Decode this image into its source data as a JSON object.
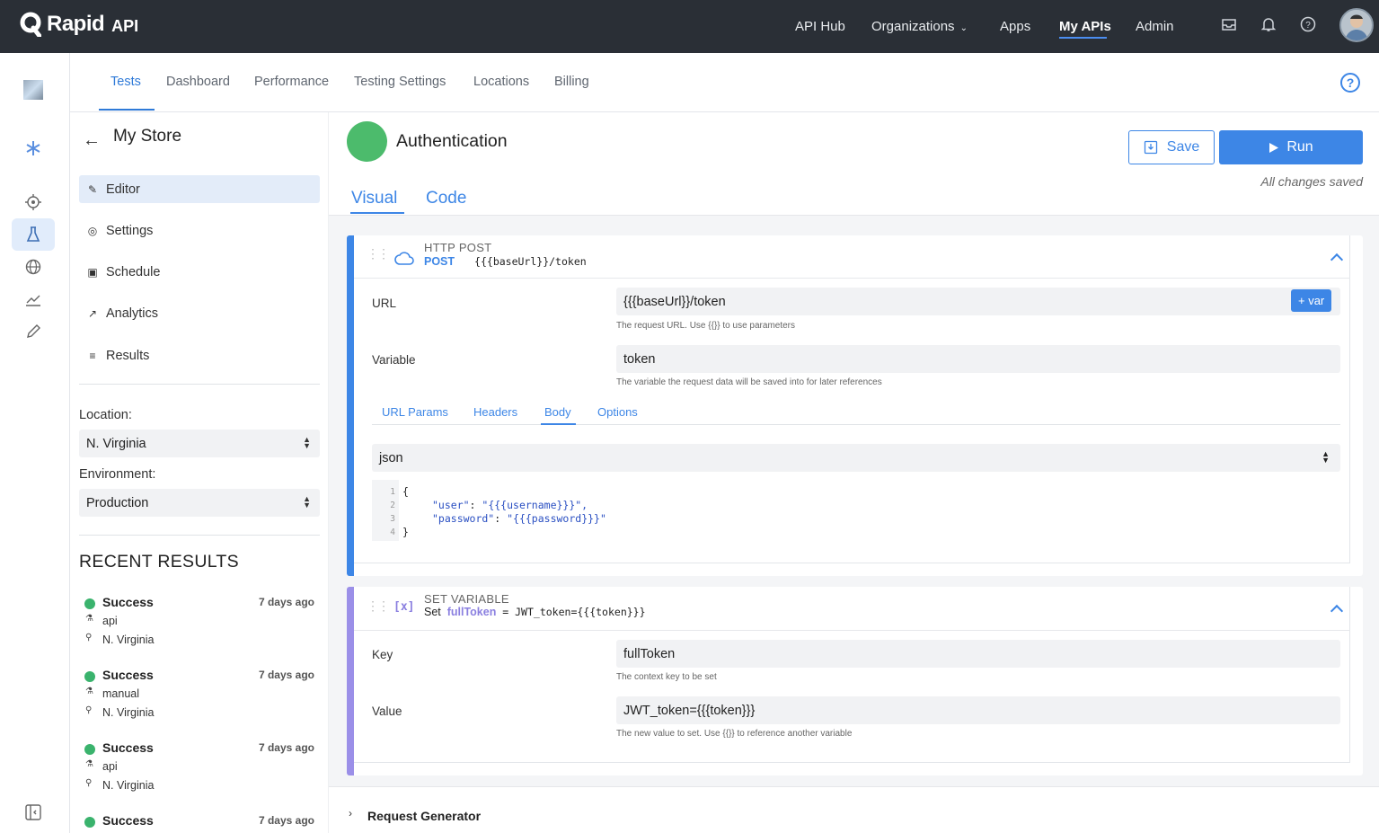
{
  "brand": {
    "name": "Rapid",
    "suffix": "API"
  },
  "topnav": {
    "items": [
      "API Hub",
      "Organizations",
      "Apps",
      "My APIs",
      "Admin"
    ],
    "active": "My APIs"
  },
  "tabs": [
    "Tests",
    "Dashboard",
    "Performance",
    "Testing Settings",
    "Locations",
    "Billing"
  ],
  "sidebar": {
    "title": "My Store",
    "menu": [
      "Editor",
      "Settings",
      "Schedule",
      "Analytics",
      "Results"
    ],
    "location_label": "Location:",
    "location_value": "N. Virginia",
    "environment_label": "Environment:",
    "environment_value": "Production",
    "recent_title": "RECENT RESULTS",
    "results": [
      {
        "status": "Success",
        "when": "7 days ago",
        "trigger": "api",
        "location": "N. Virginia"
      },
      {
        "status": "Success",
        "when": "7 days ago",
        "trigger": "manual",
        "location": "N. Virginia"
      },
      {
        "status": "Success",
        "when": "7 days ago",
        "trigger": "api",
        "location": "N. Virginia"
      },
      {
        "status": "Success",
        "when": "7 days ago",
        "trigger": "",
        "location": ""
      }
    ]
  },
  "test": {
    "name": "Authentication",
    "save_label": "Save",
    "run_label": "Run",
    "saved_status": "All changes saved",
    "view_tabs": [
      "Visual",
      "Code"
    ]
  },
  "http_step": {
    "type": "HTTP POST",
    "method": "POST",
    "path": "{{{baseUrl}}/token",
    "url_label": "URL",
    "url_value": "{{{baseUrl}}/token",
    "url_hint": "The request URL. Use {{}} to use parameters",
    "var_button": "+ var",
    "variable_label": "Variable",
    "variable_value": "token",
    "variable_hint": "The variable the request data will be saved into for later references",
    "subtabs": [
      "URL Params",
      "Headers",
      "Body",
      "Options"
    ],
    "body_format": "json",
    "code_lines": [
      {
        "n": "1",
        "text": "{"
      },
      {
        "n": "2",
        "key": "\"user\"",
        "val": "\"{{{username}}}\","
      },
      {
        "n": "3",
        "key": "\"password\"",
        "val": "\"{{{password}}}\""
      },
      {
        "n": "4",
        "text": "}"
      }
    ]
  },
  "set_step": {
    "type": "SET VARIABLE",
    "set_word": "Set",
    "var_name": "fullToken",
    "expression": "= JWT_token={{{token}}}",
    "key_label": "Key",
    "key_value": "fullToken",
    "key_hint": "The context key to be set",
    "value_label": "Value",
    "value_value": "JWT_token={{{token}}}",
    "value_hint": "The new value to set. Use {{}} to reference another variable"
  },
  "request_generator": "Request Generator",
  "colors": {
    "accent": "#3d86e6",
    "topbar": "#2a2f36",
    "success": "#3ab36d",
    "set_var": "#9b8fe8"
  }
}
